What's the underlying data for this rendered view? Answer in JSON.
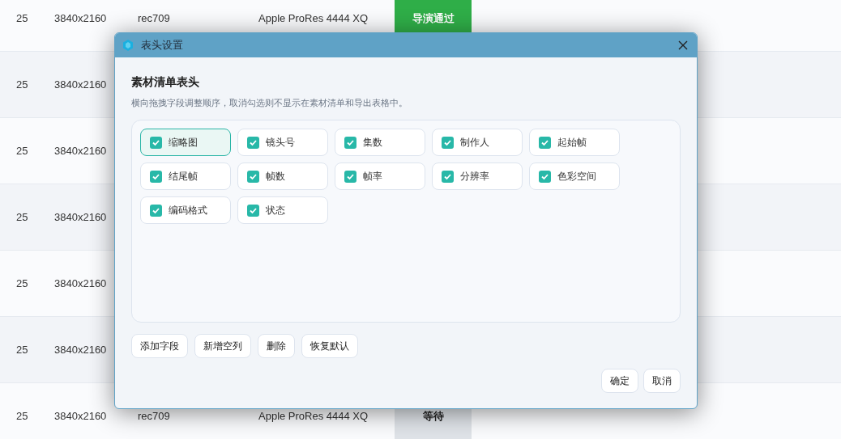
{
  "table": {
    "rows": [
      {
        "fps": "25",
        "resolution": "3840x2160",
        "color_space": "rec709",
        "codec": "Apple ProRes 4444 XQ",
        "status": {
          "text": "导演通过",
          "kind": "passed"
        }
      },
      {
        "fps": "25",
        "resolution": "3840x2160"
      },
      {
        "fps": "25",
        "resolution": "3840x2160"
      },
      {
        "fps": "25",
        "resolution": "3840x2160"
      },
      {
        "fps": "25",
        "resolution": "3840x2160"
      },
      {
        "fps": "25",
        "resolution": "3840x2160"
      },
      {
        "fps": "25",
        "resolution": "3840x2160",
        "color_space": "rec709",
        "codec": "Apple ProRes 4444 XQ",
        "status": {
          "text": "等待",
          "kind": "waiting"
        }
      }
    ]
  },
  "dialog": {
    "title": "表头设置",
    "heading": "素材清单表头",
    "hint": "横向拖拽字段调整顺序，取消勾选则不显示在素材清单和导出表格中。",
    "fields": [
      {
        "label": "缩略图",
        "checked": true,
        "selected": true
      },
      {
        "label": "镜头号",
        "checked": true,
        "selected": false
      },
      {
        "label": "集数",
        "checked": true,
        "selected": false
      },
      {
        "label": "制作人",
        "checked": true,
        "selected": false
      },
      {
        "label": "起始帧",
        "checked": true,
        "selected": false
      },
      {
        "label": "结尾帧",
        "checked": true,
        "selected": false
      },
      {
        "label": "帧数",
        "checked": true,
        "selected": false
      },
      {
        "label": "帧率",
        "checked": true,
        "selected": false
      },
      {
        "label": "分辨率",
        "checked": true,
        "selected": false
      },
      {
        "label": "色彩空间",
        "checked": true,
        "selected": false
      },
      {
        "label": "编码格式",
        "checked": true,
        "selected": false
      },
      {
        "label": "状态",
        "checked": true,
        "selected": false
      }
    ],
    "actions": [
      "添加字段",
      "新增空列",
      "删除",
      "恢复默认"
    ],
    "buttons": [
      "确定",
      "取消"
    ]
  }
}
